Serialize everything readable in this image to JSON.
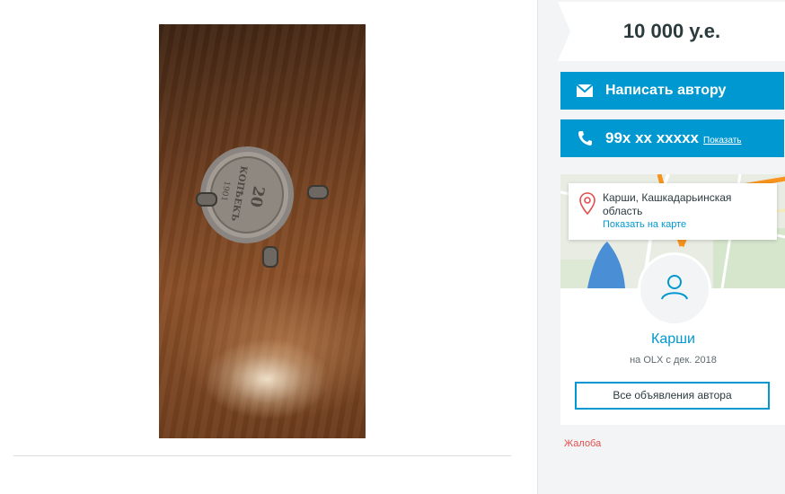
{
  "listing": {
    "photo_icon": "coin-photo"
  },
  "sidebar": {
    "price": "10 000 у.е.",
    "message_button": {
      "label": "Написать автору",
      "icon": "envelope-icon"
    },
    "phone_button": {
      "number": "99x xx xxxxx",
      "show_label": "Показать",
      "icon": "phone-icon"
    },
    "location": {
      "address": "Карши, Кашкадарьинская область",
      "show_on_map": "Показать на карте",
      "icon": "map-pin-icon"
    },
    "user": {
      "name": "Карши",
      "since": "на OLX с дек. 2018",
      "all_ads_label": "Все объявления автора",
      "avatar_icon": "user-icon"
    },
    "complaint_label": "Жалоба"
  },
  "colors": {
    "accent": "#0098d0",
    "text_dark": "#2b3a3d",
    "complaint": "#e34e4e",
    "sidebar_bg": "#f2f4f5"
  }
}
